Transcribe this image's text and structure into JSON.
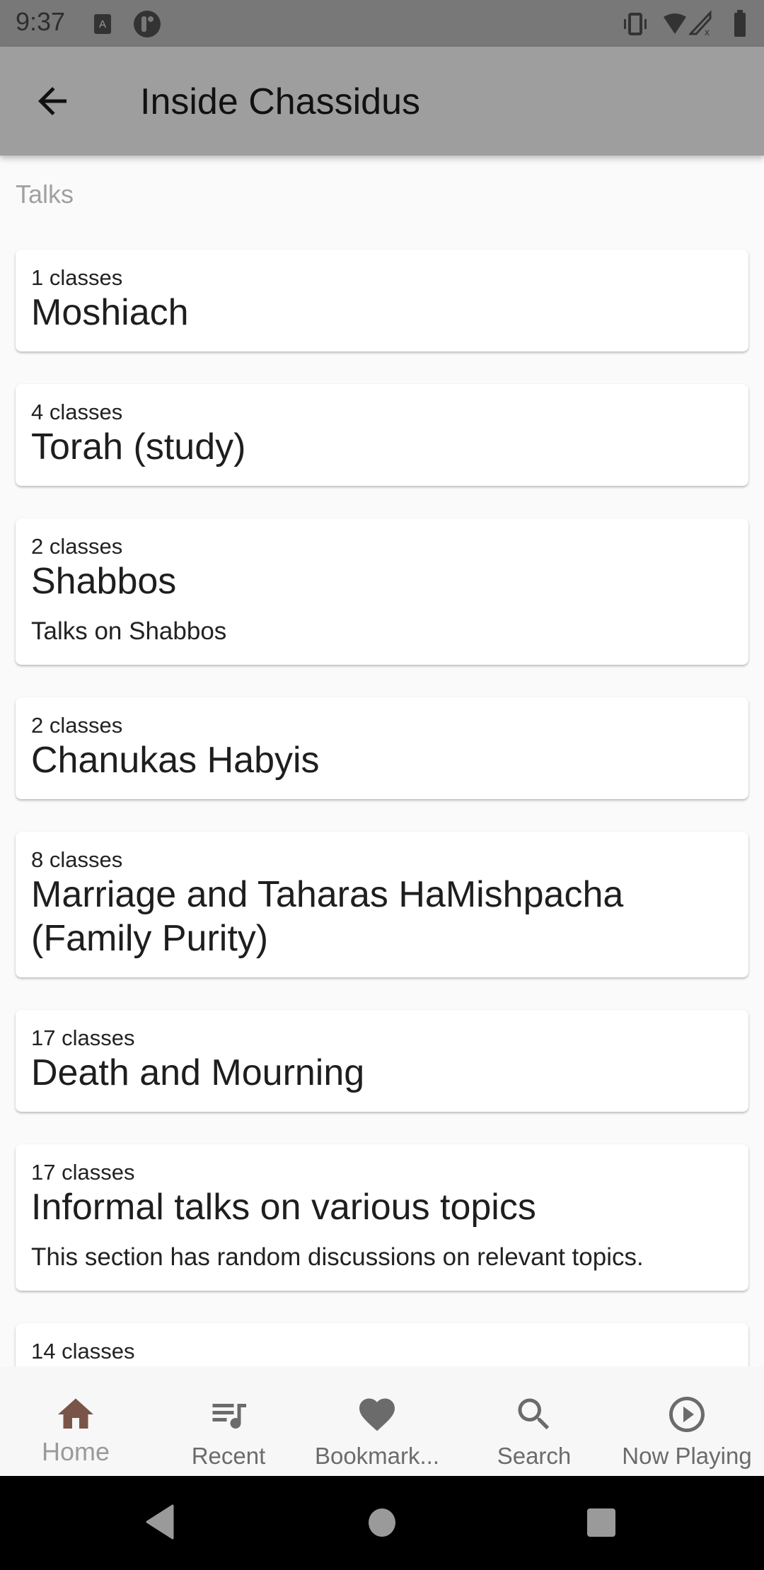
{
  "status_bar": {
    "time": "9:37",
    "left_icons": [
      "notification-a-icon",
      "notification-app-icon"
    ],
    "right_icons": [
      "vibrate-icon",
      "wifi-icon",
      "signal-icon",
      "battery-icon"
    ]
  },
  "app_bar": {
    "title": "Inside Chassidus",
    "back_icon": "arrow-left-icon"
  },
  "section": {
    "label": "Talks"
  },
  "cards": [
    {
      "count": "1 classes",
      "title": "Moshiach",
      "description": null
    },
    {
      "count": "4 classes",
      "title": "Torah (study)",
      "description": null
    },
    {
      "count": "2 classes",
      "title": "Shabbos",
      "description": "Talks on Shabbos"
    },
    {
      "count": "2 classes",
      "title": "Chanukas Habyis",
      "description": null
    },
    {
      "count": "8 classes",
      "title": "Marriage and Taharas HaMishpacha (Family Purity)",
      "description": null
    },
    {
      "count": "17 classes",
      "title": "Death and Mourning",
      "description": null
    },
    {
      "count": "17 classes",
      "title": "Informal talks on various topics",
      "description": "This section has random discussions on relevant topics."
    },
    {
      "count": "14 classes",
      "title": "",
      "description": null
    }
  ],
  "bottom_nav": {
    "active_color": "#795548",
    "inactive_color": "#6b6b6b",
    "items": [
      {
        "label": "Home",
        "icon": "home-icon",
        "active": true
      },
      {
        "label": "Recent",
        "icon": "queue-music-icon",
        "active": false
      },
      {
        "label": "Bookmark...",
        "icon": "heart-icon",
        "active": false
      },
      {
        "label": "Search",
        "icon": "search-icon",
        "active": false
      },
      {
        "label": "Now Playing",
        "icon": "play-circle-icon",
        "active": false
      }
    ]
  },
  "system_nav": {
    "icons": [
      "back-triangle-icon",
      "home-circle-icon",
      "recents-square-icon"
    ]
  }
}
